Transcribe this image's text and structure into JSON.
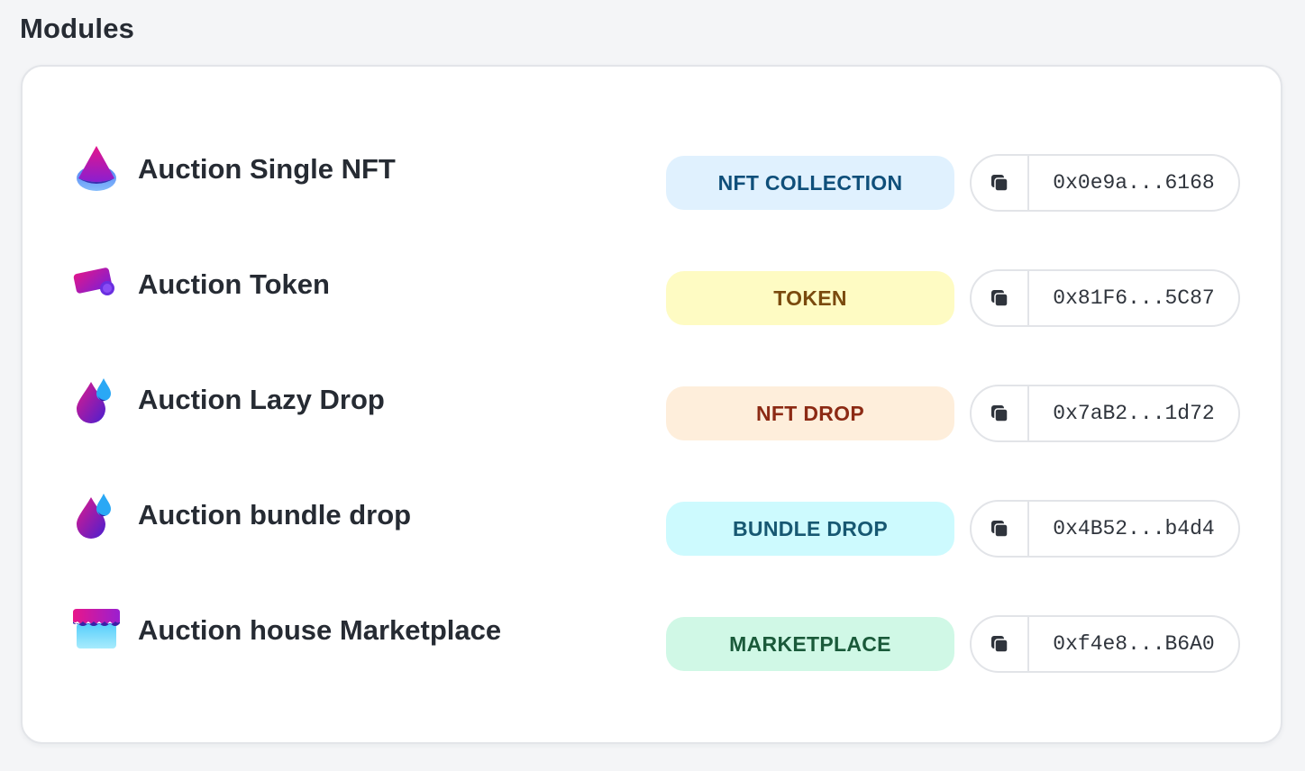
{
  "section_title": "Modules",
  "modules": [
    {
      "name": "Auction Single NFT",
      "icon": "drop-pyramid-icon",
      "badge": {
        "label": "NFT COLLECTION",
        "bg": "#e0f1fe",
        "fg": "#0f4f7a"
      },
      "address": "0x0e9a...6168"
    },
    {
      "name": "Auction Token",
      "icon": "token-card-icon",
      "badge": {
        "label": "TOKEN",
        "bg": "#fefbc3",
        "fg": "#7a4a0e"
      },
      "address": "0x81F6...5C87"
    },
    {
      "name": "Auction Lazy Drop",
      "icon": "water-drop-icon",
      "badge": {
        "label": "NFT DROP",
        "bg": "#feeedb",
        "fg": "#8c2a14"
      },
      "address": "0x7aB2...1d72"
    },
    {
      "name": "Auction bundle drop",
      "icon": "water-drop-icon",
      "badge": {
        "label": "BUNDLE DROP",
        "bg": "#cdfafe",
        "fg": "#175872"
      },
      "address": "0x4B52...b4d4"
    },
    {
      "name": "Auction house Marketplace",
      "icon": "storefront-icon",
      "badge": {
        "label": "MARKETPLACE",
        "bg": "#d0f8e6",
        "fg": "#1a5a3a"
      },
      "address": "0xf4e8...B6A0"
    }
  ],
  "copy_icon": "copy-icon"
}
